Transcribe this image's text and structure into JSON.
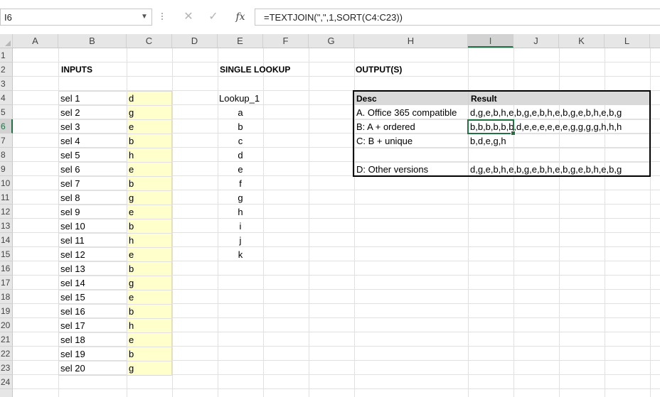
{
  "formula_bar": {
    "name_box": "I6",
    "cancel_icon": "✕",
    "enter_icon": "✓",
    "fx_label": "fx",
    "formula": "=TEXTJOIN(\",\",1,SORT(C4:C23))"
  },
  "columns": [
    "A",
    "B",
    "C",
    "D",
    "E",
    "F",
    "G",
    "H",
    "I",
    "J",
    "K",
    "L"
  ],
  "selected_column": "I",
  "rows": [
    "1",
    "2",
    "3",
    "4",
    "5",
    "6",
    "7",
    "8",
    "9",
    "10",
    "11",
    "12",
    "13",
    "14",
    "15",
    "16",
    "17",
    "18",
    "19",
    "20",
    "21",
    "22",
    "23",
    "24"
  ],
  "selected_row": "6",
  "headings": {
    "inputs": "INPUTS",
    "single_lookup": "SINGLE LOOKUP",
    "outputs": "OUTPUT(S)"
  },
  "inputs": [
    {
      "label": "sel 1",
      "value": "d"
    },
    {
      "label": "sel 2",
      "value": "g"
    },
    {
      "label": "sel 3",
      "value": "e"
    },
    {
      "label": "sel 4",
      "value": "b"
    },
    {
      "label": "sel 5",
      "value": "h"
    },
    {
      "label": "sel 6",
      "value": "e"
    },
    {
      "label": "sel 7",
      "value": "b"
    },
    {
      "label": "sel 8",
      "value": "g"
    },
    {
      "label": "sel 9",
      "value": "e"
    },
    {
      "label": "sel 10",
      "value": "b"
    },
    {
      "label": "sel 11",
      "value": "h"
    },
    {
      "label": "sel 12",
      "value": "e"
    },
    {
      "label": "sel 13",
      "value": "b"
    },
    {
      "label": "sel 14",
      "value": "g"
    },
    {
      "label": "sel 15",
      "value": "e"
    },
    {
      "label": "sel 16",
      "value": "b"
    },
    {
      "label": "sel 17",
      "value": "h"
    },
    {
      "label": "sel 18",
      "value": "e"
    },
    {
      "label": "sel 19",
      "value": "b"
    },
    {
      "label": "sel 20",
      "value": "g"
    }
  ],
  "lookup": {
    "title": "Lookup_1",
    "values": [
      "a",
      "b",
      "c",
      "d",
      "e",
      "f",
      "g",
      "h",
      "i",
      "j",
      "k"
    ]
  },
  "output": {
    "header_desc": "Desc",
    "header_result": "Result",
    "rows": [
      {
        "desc": "A. Office 365 compatible",
        "result": "d,g,e,b,h,e,b,g,e,b,h,e,b,g,e,b,h,e,b,g"
      },
      {
        "desc": "B: A + ordered",
        "result": "b,b,b,b,b,b,d,e,e,e,e,e,e,g,g,g,g,h,h,h"
      },
      {
        "desc": "C: B + unique",
        "result": "b,d,e,g,h"
      },
      {
        "desc": "",
        "result": ""
      },
      {
        "desc": "D: Other versions",
        "result": "d,g,e,b,h,e,b,g,e,b,h,e,b,g,e,b,h,e,b,g"
      }
    ]
  },
  "colors": {
    "accent": "#217346",
    "input_fill": "#ffffcc",
    "header_fill": "#e6e6e6"
  }
}
